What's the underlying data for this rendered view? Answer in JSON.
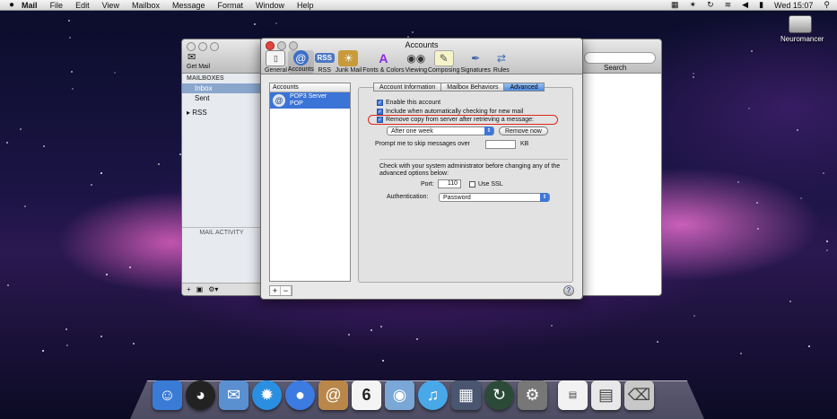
{
  "menubar": {
    "apple": "",
    "items": [
      "Mail",
      "File",
      "Edit",
      "View",
      "Mailbox",
      "Message",
      "Format",
      "Window",
      "Help"
    ],
    "clock": "Wed 15:07"
  },
  "desktop": {
    "disk_label": "Neuromancer"
  },
  "mail_window": {
    "get_mail": "Get Mail",
    "search_label": "Search",
    "mailboxes_header": "MAILBOXES",
    "inbox": "Inbox",
    "sent": "Sent",
    "rss": "RSS",
    "mail_activity": "MAIL ACTIVITY"
  },
  "dialog": {
    "title": "Accounts",
    "toolbar": [
      {
        "label": "General",
        "icon": "switch-icon"
      },
      {
        "label": "Accounts",
        "icon": "at-icon"
      },
      {
        "label": "RSS",
        "icon": "rss-icon"
      },
      {
        "label": "Junk Mail",
        "icon": "junk-mail-icon"
      },
      {
        "label": "Fonts & Colors",
        "icon": "fonts-colors-icon"
      },
      {
        "label": "Viewing",
        "icon": "glasses-icon"
      },
      {
        "label": "Composing",
        "icon": "composing-icon"
      },
      {
        "label": "Signatures",
        "icon": "signature-icon"
      },
      {
        "label": "Rules",
        "icon": "rules-icon"
      }
    ],
    "accounts_header": "Accounts",
    "account_name": "POP3 Server",
    "account_type": "POP",
    "tabs": [
      "Account Information",
      "Mailbox Behaviors",
      "Advanced"
    ],
    "selected_tab": "Advanced",
    "options": {
      "enable": "Enable this account",
      "include": "Include when automatically checking for new mail",
      "remove_copy": "Remove copy from server after retrieving a message:"
    },
    "after_popup": "After one week",
    "remove_now": "Remove now",
    "prompt_label": "Prompt me to skip messages over",
    "prompt_value": "",
    "kb": "KB",
    "admin_note": "Check with your system administrator before changing any of the advanced options below:",
    "port_label": "Port:",
    "port_value": "110",
    "use_ssl": "Use SSL",
    "auth_label": "Authentication:",
    "auth_value": "Password",
    "help": "?"
  }
}
